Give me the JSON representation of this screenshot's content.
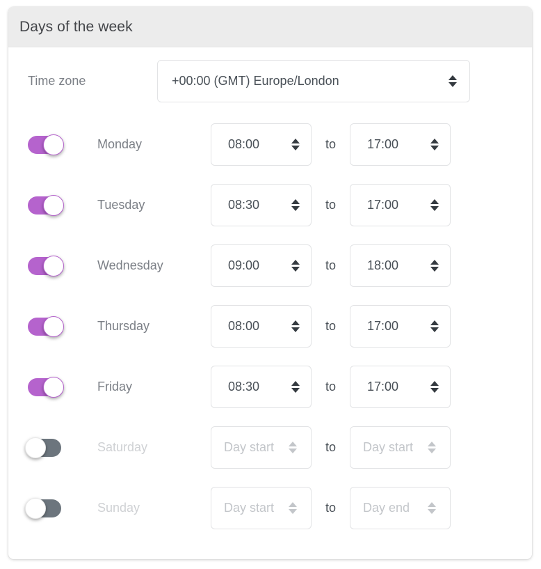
{
  "card": {
    "header_title": "Days of the week"
  },
  "timezone": {
    "label": "Time zone",
    "value": "+00:00 (GMT) Europe/London"
  },
  "separator_label": "to",
  "days": [
    {
      "name": "Monday",
      "enabled": true,
      "start": "08:00",
      "end": "17:00"
    },
    {
      "name": "Tuesday",
      "enabled": true,
      "start": "08:30",
      "end": "17:00"
    },
    {
      "name": "Wednesday",
      "enabled": true,
      "start": "09:00",
      "end": "18:00"
    },
    {
      "name": "Thursday",
      "enabled": true,
      "start": "08:00",
      "end": "17:00"
    },
    {
      "name": "Friday",
      "enabled": true,
      "start": "08:30",
      "end": "17:00"
    },
    {
      "name": "Saturday",
      "enabled": false,
      "start": "Day start",
      "end": "Day start"
    },
    {
      "name": "Sunday",
      "enabled": false,
      "start": "Day start",
      "end": "Day end"
    }
  ],
  "colors": {
    "toggle_on": "#b563cd",
    "toggle_off": "#6c757d",
    "header_bg": "#ececec",
    "label_text": "#7b7f86",
    "disabled_text": "#cfd1d4"
  }
}
